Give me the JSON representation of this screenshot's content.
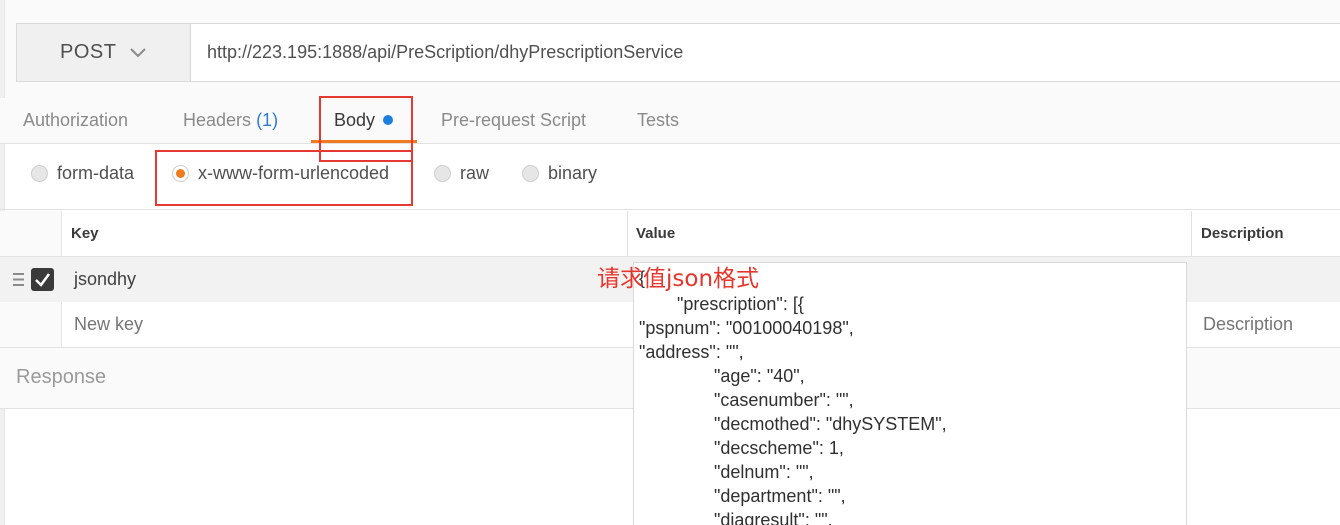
{
  "request": {
    "method": "POST",
    "url": "http://223.195:1888/api/PreScription/dhyPrescriptionService"
  },
  "tabs": [
    {
      "label": "Authorization"
    },
    {
      "label": "Headers",
      "count": "(1)"
    },
    {
      "label": "Body",
      "active": true
    },
    {
      "label": "Pre-request Script"
    },
    {
      "label": "Tests"
    }
  ],
  "body_types": [
    {
      "label": "form-data",
      "selected": false
    },
    {
      "label": "x-www-form-urlencoded",
      "selected": true
    },
    {
      "label": "raw",
      "selected": false
    },
    {
      "label": "binary",
      "selected": false
    }
  ],
  "params_table": {
    "columns": [
      "Key",
      "Value",
      "Description"
    ],
    "rows": [
      {
        "checked": true,
        "key": "jsondhy"
      }
    ],
    "new_row": {
      "key_placeholder": "New key",
      "description_placeholder": "Description"
    }
  },
  "response": {
    "label": "Response"
  },
  "value_popup": {
    "lines": [
      "{",
      "\"prescription\": [{",
      "\"pspnum\": \"00100040198\",",
      "\"address\": \"\",",
      "\"age\": \"40\",",
      "\"casenumber\": \"\",",
      "\"decmothed\": \"dhySYSTEM\",",
      "\"decscheme\": 1,",
      "\"delnum\": \"\",",
      "\"department\": \"\",",
      "\"diagresult\": \"\","
    ]
  },
  "annotation": {
    "text": "请求值json格式"
  },
  "colors": {
    "accent_orange": "#f07b1f",
    "highlight_red": "#e53935",
    "annotation_red": "#e8352b",
    "dot_blue": "#1b7fe0",
    "count_blue": "#2f7cd0"
  },
  "icons": [
    "chevron-down-icon",
    "drag-handle-icon",
    "checkmark-icon"
  ]
}
